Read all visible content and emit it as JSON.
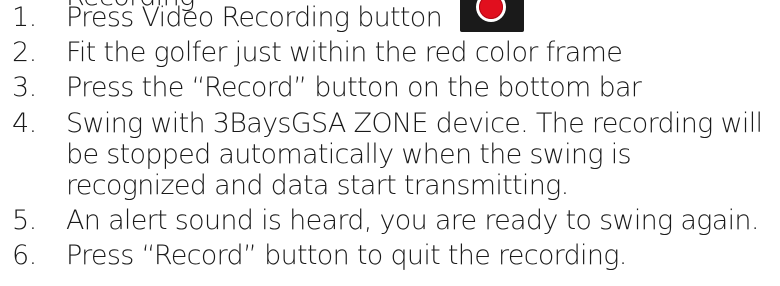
{
  "partial_heading": "Recording",
  "steps": [
    {
      "num": "1.",
      "text": "Press Video Recording button",
      "icon": "record-button-icon"
    },
    {
      "num": "2.",
      "text": "Fit the golfer just within the red color frame"
    },
    {
      "num": "3.",
      "text": "Press the “Record” button on the bottom bar"
    },
    {
      "num": "4.",
      "text": "Swing with 3BaysGSA ZONE device.  The recording will be stopped automatically when the swing is recognized and data start transmitting."
    },
    {
      "num": "5.",
      "text": "An alert sound is heard, you are ready to swing again."
    },
    {
      "num": "6.",
      "text": "Press “Record” button to quit the recording."
    }
  ],
  "colors": {
    "text": "#1a1a1a",
    "record_red": "#e10f1e",
    "button_bg": "#1a1a1a"
  }
}
